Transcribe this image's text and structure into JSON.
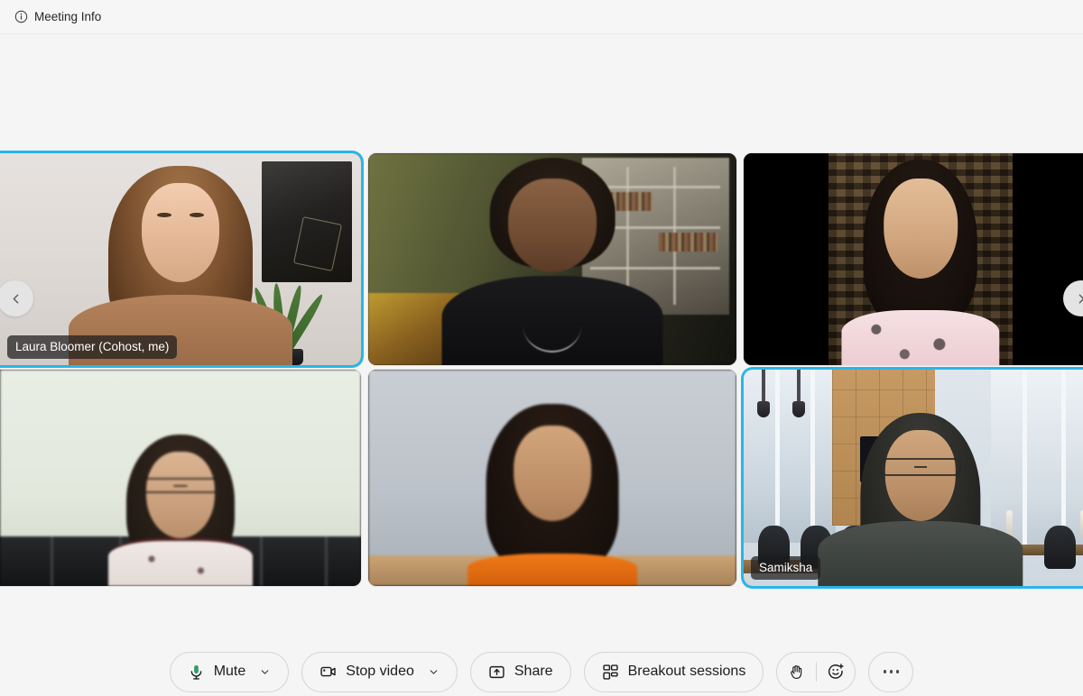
{
  "header": {
    "meeting_info_label": "Meeting Info",
    "info_icon": "info-circle-icon"
  },
  "theme": {
    "page_background": "#f5f5f5",
    "active_speaker_border": "#28b6e8",
    "mic_icon_color": "#2e9e6b",
    "name_badge_background": "rgba(28,28,28,0.72)",
    "toolbar_button_border": "#d5d5d5"
  },
  "stage": {
    "nav_prev_icon": "chevron-left-icon",
    "nav_next_icon": "chevron-right-icon",
    "participants": [
      {
        "name": "Laura Bloomer (Cohost, me)",
        "show_name": true,
        "active_speaker": true
      },
      {
        "name": "",
        "show_name": false,
        "active_speaker": false
      },
      {
        "name": "",
        "show_name": false,
        "active_speaker": false
      },
      {
        "name": "",
        "show_name": false,
        "active_speaker": false
      },
      {
        "name": "",
        "show_name": false,
        "active_speaker": false
      },
      {
        "name": "Samiksha",
        "show_name": true,
        "active_speaker": true
      }
    ]
  },
  "toolbar": {
    "mute_label": "Mute",
    "mute_icon": "microphone-icon",
    "mute_caret_icon": "chevron-down-icon",
    "stop_video_label": "Stop video",
    "stop_video_icon": "video-camera-icon",
    "stop_video_caret_icon": "chevron-down-icon",
    "share_label": "Share",
    "share_icon": "share-screen-icon",
    "breakout_label": "Breakout sessions",
    "breakout_icon": "grid-squares-icon",
    "raise_hand_icon": "raised-hand-icon",
    "reactions_icon": "smiley-plus-icon",
    "more_icon": "ellipsis-icon"
  }
}
